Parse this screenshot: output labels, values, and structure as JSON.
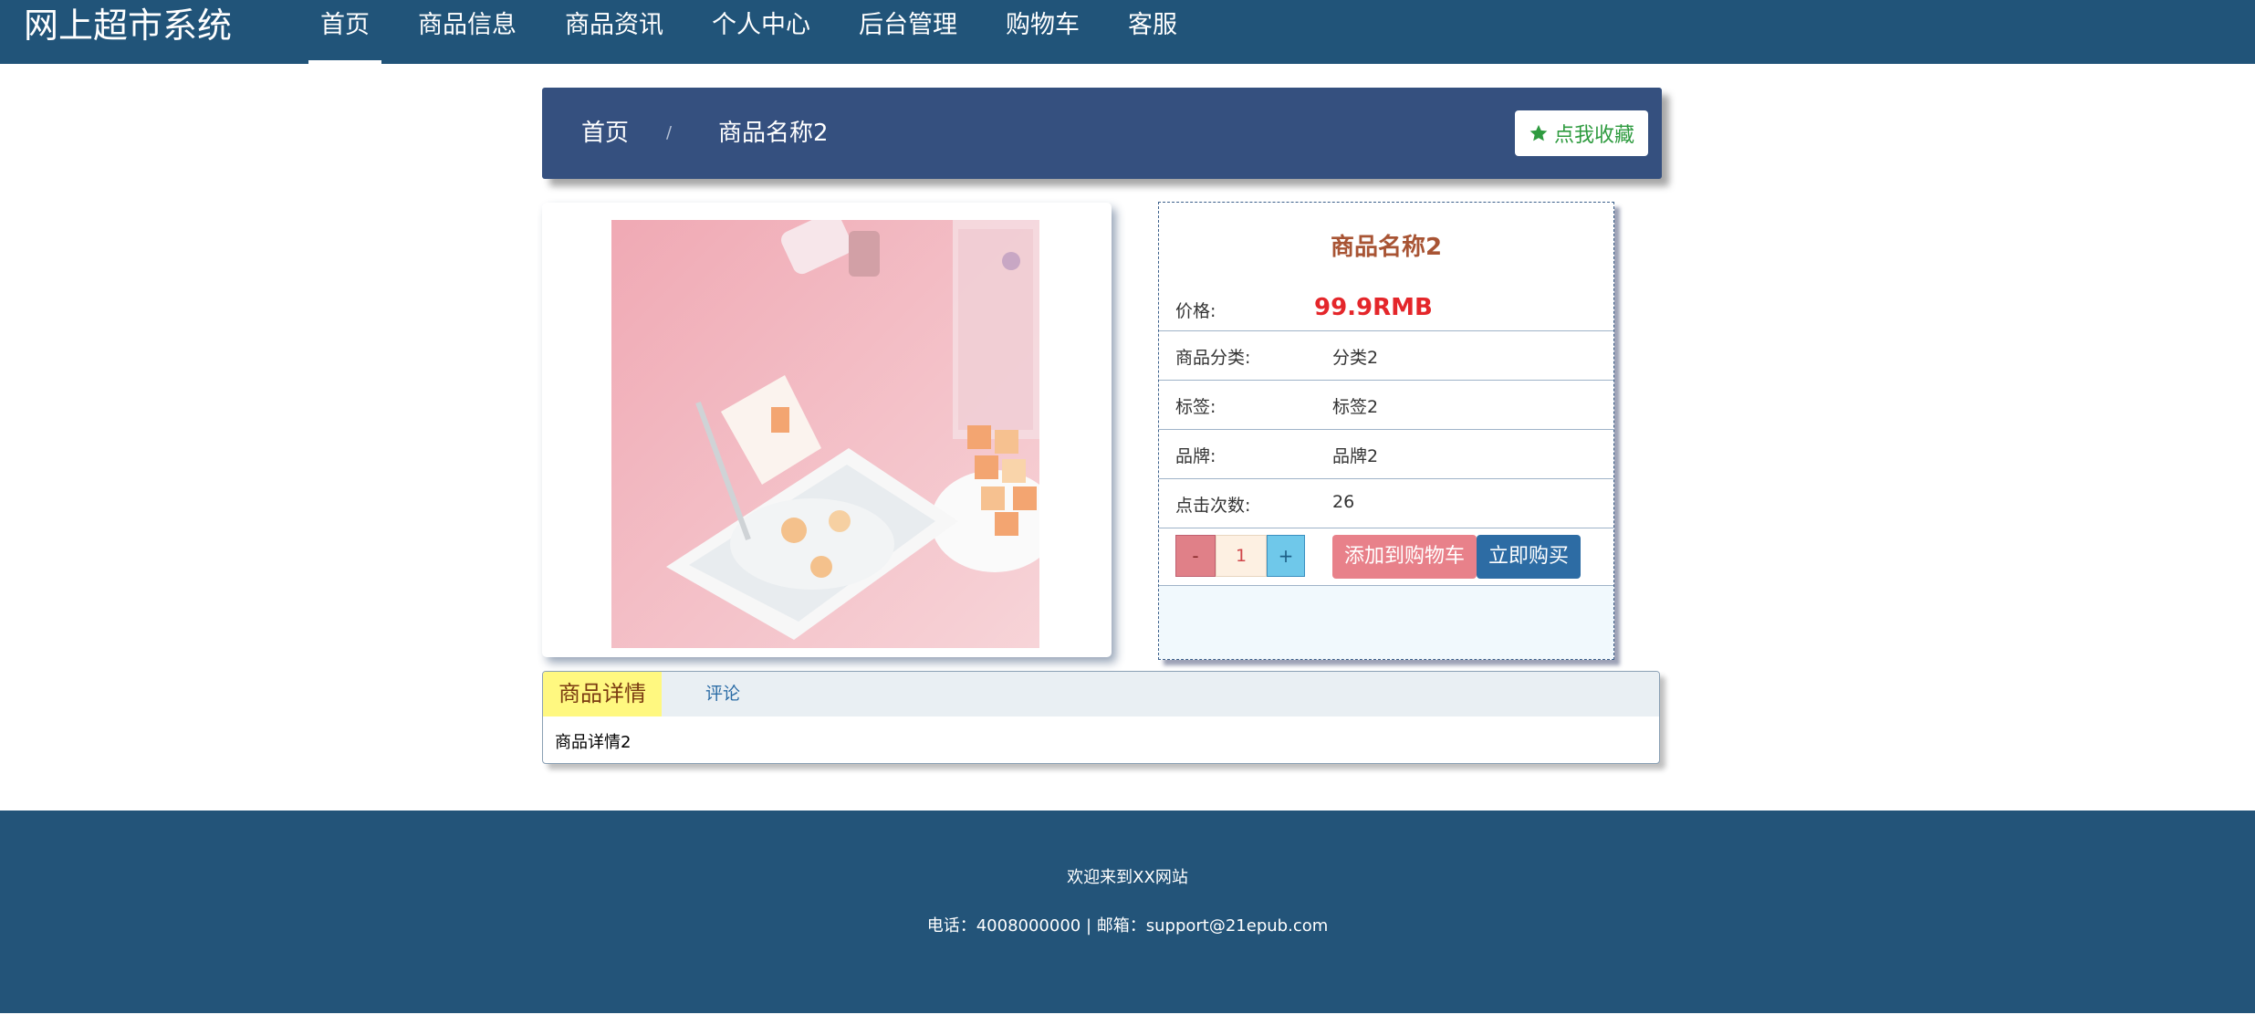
{
  "header": {
    "site_title": "网上超市系统",
    "nav": [
      "首页",
      "商品信息",
      "商品资讯",
      "个人中心",
      "后台管理",
      "购物车",
      "客服"
    ]
  },
  "breadcrumb": {
    "home": "首页",
    "separator": "/",
    "current": "商品名称2",
    "favorite_label": "点我收藏"
  },
  "product": {
    "name": "商品名称2",
    "price_label": "价格:",
    "price": "99.9RMB",
    "category_label": "商品分类:",
    "category": "分类2",
    "tag_label": "标签:",
    "tag": "标签2",
    "brand_label": "品牌:",
    "brand": "品牌2",
    "clicks_label": "点击次数:",
    "clicks": "26",
    "quantity": "1",
    "minus": "-",
    "plus": "+",
    "add_to_cart": "添加到购物车",
    "buy_now": "立即购买"
  },
  "tabs": {
    "detail": "商品详情",
    "review": "评论",
    "content": "商品详情2"
  },
  "footer": {
    "welcome": "欢迎来到XX网站",
    "contact": "电话：4008000000 | 邮箱：support@21epub.com"
  },
  "colors": {
    "topbar": "#215479",
    "breadcrumb_bar": "#35507f",
    "price": "#e4262a",
    "product_name": "#a85434"
  }
}
